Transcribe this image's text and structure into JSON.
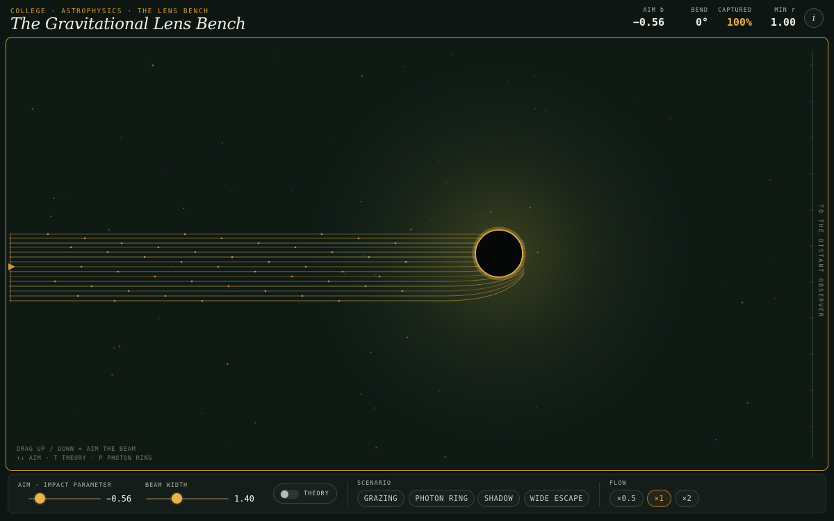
{
  "header": {
    "breadcrumb": "COLLEGE · ASTROPHYSICS · THE LENS BENCH",
    "title": "The Gravitational Lens Bench",
    "stats": {
      "aim": {
        "label": "AIM b",
        "value": "−0.56"
      },
      "bend": {
        "label": "BEND",
        "value": "0°"
      },
      "captured": {
        "label": "CAPTURED",
        "value": "100%"
      },
      "min_r": {
        "label": "MIN r",
        "value": "1.00"
      }
    },
    "info_icon": "info-icon",
    "info_glyph": "i"
  },
  "stage": {
    "observer_label": "TO THE DISTANT OBSERVER",
    "hint_line_1": "DRAG UP / DOWN = AIM THE BEAM",
    "hint_line_2": "↑↓ AIM · T THEORY · P PHOTON RING",
    "source_icon": "beam-source-arrow-icon",
    "black_hole_icon": "black-hole-icon"
  },
  "controls": {
    "aim": {
      "label": "AIM · IMPACT PARAMETER",
      "value": "−0.56",
      "fraction": 0.1
    },
    "beam_width": {
      "label": "BEAM WIDTH",
      "value": "1.40",
      "fraction": 0.36
    },
    "theory": {
      "label": "THEORY",
      "on": false
    },
    "scenario": {
      "label": "SCENARIO",
      "options": [
        "GRAZING",
        "PHOTON RING",
        "SHADOW",
        "WIDE ESCAPE"
      ]
    },
    "flow": {
      "label": "FLOW",
      "options": [
        "×0.5",
        "×1",
        "×2"
      ],
      "selected": "×1"
    }
  },
  "colors": {
    "accent": "#e9b04f",
    "frame": "#c99a45",
    "background": "#0d1612",
    "ray": "#b89546"
  }
}
